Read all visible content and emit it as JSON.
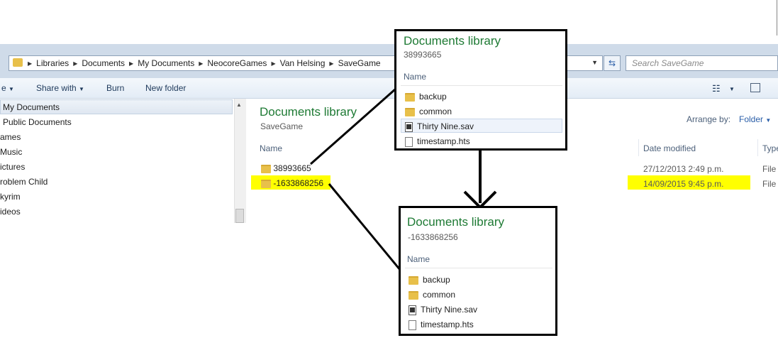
{
  "address_bar": {
    "crumbs": [
      "Libraries",
      "Documents",
      "My Documents",
      "NeocoreGames",
      "Van Helsing",
      "SaveGame"
    ],
    "search_placeholder": "Search SaveGame"
  },
  "toolbar": {
    "organize_label": "e",
    "share_label": "Share with",
    "burn_label": "Burn",
    "new_folder_label": "New folder"
  },
  "nav_pane": {
    "items": [
      "My Documents",
      "Public Documents",
      "ames",
      "Music",
      "ictures",
      "roblem Child",
      "kyrim",
      "ideos"
    ]
  },
  "main": {
    "title": "Documents library",
    "subtitle": "SaveGame",
    "arrange_label": "Arrange by:",
    "arrange_value": "Folder",
    "columns": {
      "name": "Name",
      "date": "Date modified",
      "type": "Type"
    },
    "rows": [
      {
        "name": "38993665",
        "date": "27/12/2013 2:49 p.m.",
        "type": "File f"
      },
      {
        "name": "-1633868256",
        "date": "14/09/2015 9:45 p.m.",
        "type": "File f"
      }
    ],
    "highlight_color": "#ffff00"
  },
  "popup_top": {
    "title": "Documents library",
    "subtitle": "38993665",
    "column": "Name",
    "items": [
      {
        "name": "backup",
        "icon": "folder-icon"
      },
      {
        "name": "common",
        "icon": "folder-icon"
      },
      {
        "name": "Thirty Nine.sav",
        "icon": "save-file-icon"
      },
      {
        "name": "timestamp.hts",
        "icon": "document-icon"
      }
    ]
  },
  "popup_bottom": {
    "title": "Documents library",
    "subtitle": "-1633868256",
    "column": "Name",
    "items": [
      {
        "name": "backup",
        "icon": "folder-icon"
      },
      {
        "name": "common",
        "icon": "folder-icon"
      },
      {
        "name": "Thirty Nine.sav",
        "icon": "save-file-icon"
      },
      {
        "name": "timestamp.hts",
        "icon": "document-icon"
      }
    ]
  },
  "colors": {
    "library_title": "#1e7a34",
    "annotation": "#000000"
  }
}
